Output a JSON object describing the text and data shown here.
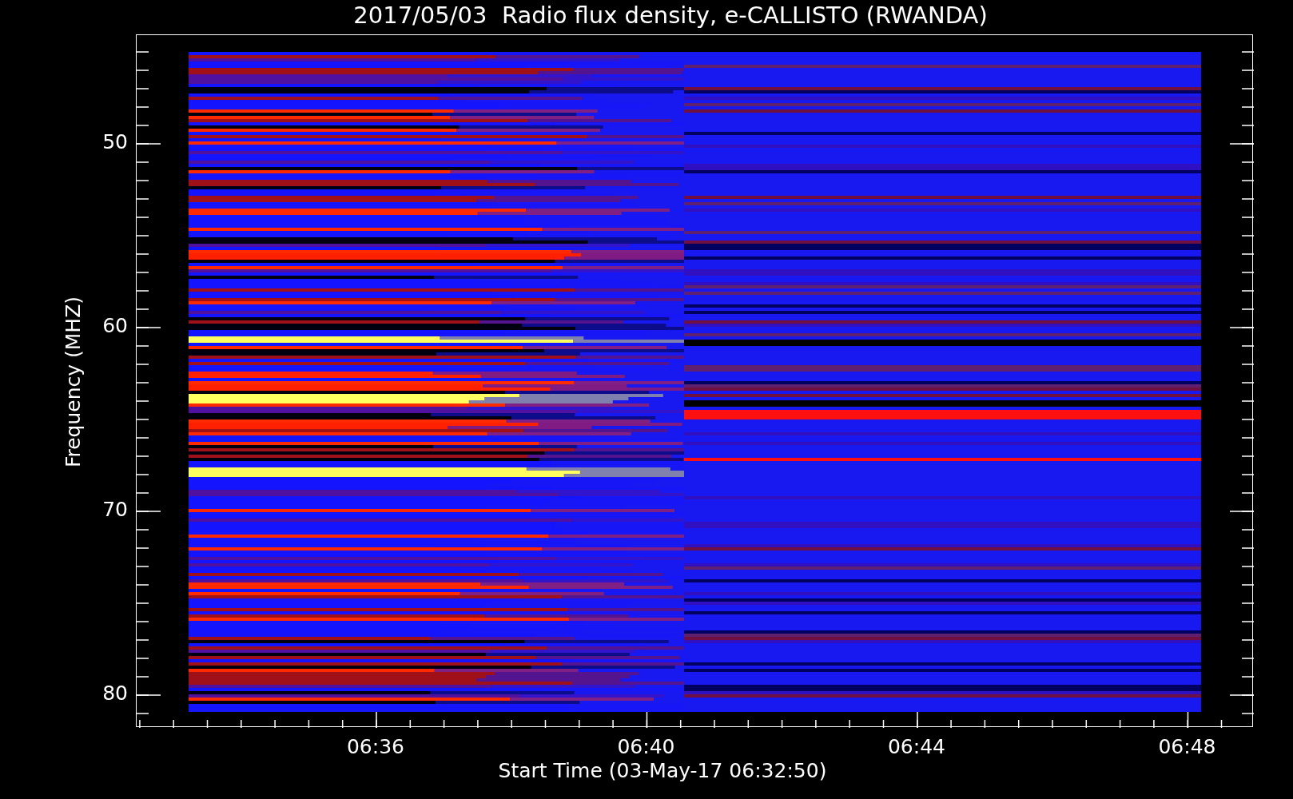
{
  "chart": {
    "title": "2017/05/03  Radio flux density, e-CALLISTO (RWANDA)",
    "ylabel": "Frequency (MHZ)",
    "xlabel": "Start Time (03-May-17 06:32:50)",
    "yticks": [
      "50",
      "60",
      "70",
      "80"
    ],
    "xticks": [
      "06:36",
      "06:40",
      "06:44",
      "06:48"
    ]
  }
}
